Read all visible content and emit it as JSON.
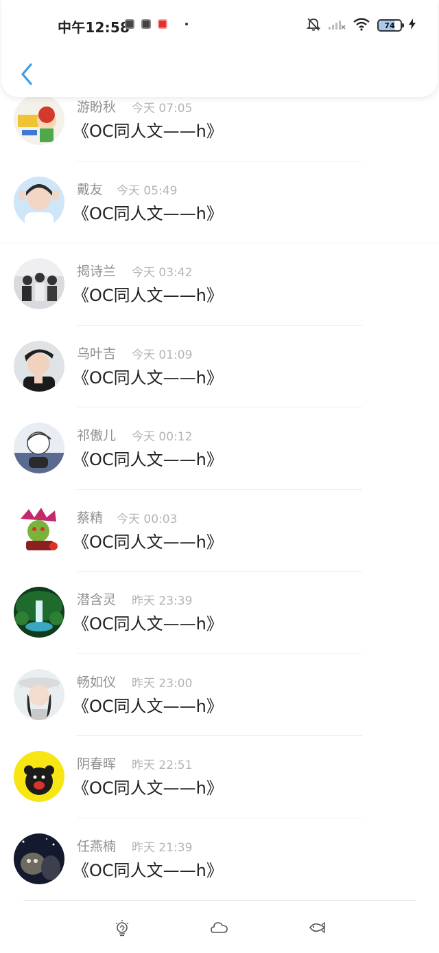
{
  "status_bar": {
    "time": "中午12:58",
    "battery": "74"
  },
  "messages": [
    {
      "name": "游盼秋",
      "time": "今天 07:05",
      "text": "《OC同人文——h》"
    },
    {
      "name": "戴友",
      "time": "今天 05:49",
      "text": "《OC同人文——h》"
    },
    {
      "name": "揭诗兰",
      "time": "今天 03:42",
      "text": "《OC同人文——h》"
    },
    {
      "name": "乌叶吉",
      "time": "今天 01:09",
      "text": "《OC同人文——h》"
    },
    {
      "name": "祁傲儿",
      "time": "今天 00:12",
      "text": "《OC同人文——h》"
    },
    {
      "name": "蔡精",
      "time": "今天 00:03",
      "text": "《OC同人文——h》"
    },
    {
      "name": "潜含灵",
      "time": "昨天 23:39",
      "text": "《OC同人文——h》"
    },
    {
      "name": "畅如仪",
      "time": "昨天 23:00",
      "text": "《OC同人文——h》"
    },
    {
      "name": "阴春晖",
      "time": "昨天 22:51",
      "text": "《OC同人文——h》"
    },
    {
      "name": "任燕楠",
      "time": "昨天 21:39",
      "text": "《OC同人文——h》"
    }
  ],
  "icons": {
    "back": "chevron-left-icon",
    "nav": [
      "lightbulb-icon",
      "cloud-icon",
      "fish-icon"
    ]
  },
  "colors": {
    "accent": "#3a9be8",
    "name_text": "#8f8f8f",
    "time_text": "#b4b4b4",
    "body_text": "#222222"
  }
}
